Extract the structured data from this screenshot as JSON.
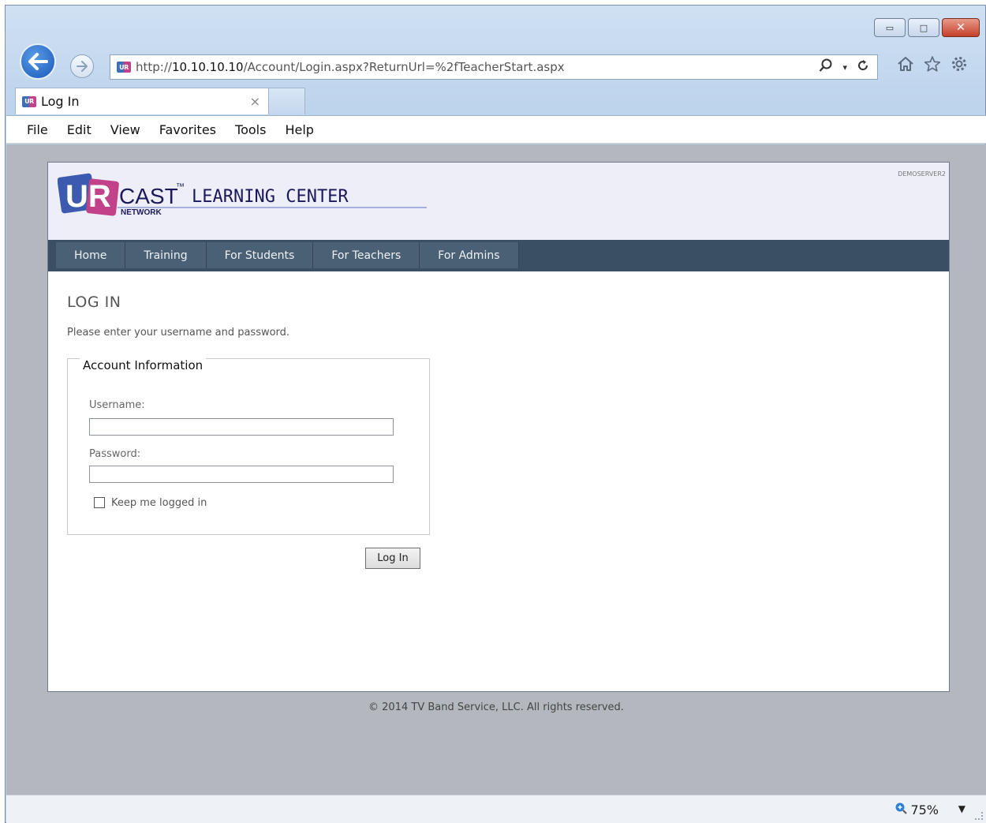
{
  "browser": {
    "address": {
      "prefix": "http://",
      "host": "10.10.10.10",
      "path": "/Account/Login.aspx?ReturnUrl=%2fTeacherStart.aspx"
    },
    "tab": {
      "title": "Log In",
      "close": "×"
    },
    "menu": [
      "File",
      "Edit",
      "View",
      "Favorites",
      "Tools",
      "Help"
    ],
    "window_buttons": {
      "minimize": "▭",
      "maximize": "□",
      "close": "✕"
    },
    "status": {
      "zoom": "75%",
      "zoom_dropdown": "▼"
    }
  },
  "site": {
    "logo": {
      "letters": "UR",
      "cast": "CAST",
      "tm": "™",
      "title": "LEARNING CENTER",
      "network": "NETWORK"
    },
    "server_name": "DEMOSERVER2",
    "nav": [
      "Home",
      "Training",
      "For Students",
      "For Teachers",
      "For Admins"
    ]
  },
  "login": {
    "heading": "LOG IN",
    "instructions": "Please enter your username and password.",
    "legend": "Account Information",
    "username_label": "Username:",
    "username_value": "",
    "password_label": "Password:",
    "password_value": "",
    "remember_label": "Keep me logged in",
    "remember_checked": false,
    "submit_label": "Log In"
  },
  "footer": {
    "text": "© 2014 TV Band Service, LLC. All rights reserved."
  },
  "colors": {
    "nav_background": "#3a4f63",
    "nav_item": "#4a6075",
    "header_background": "#eeeef9",
    "logo_blue": "#3c5bb0",
    "logo_pink": "#c2428a"
  }
}
